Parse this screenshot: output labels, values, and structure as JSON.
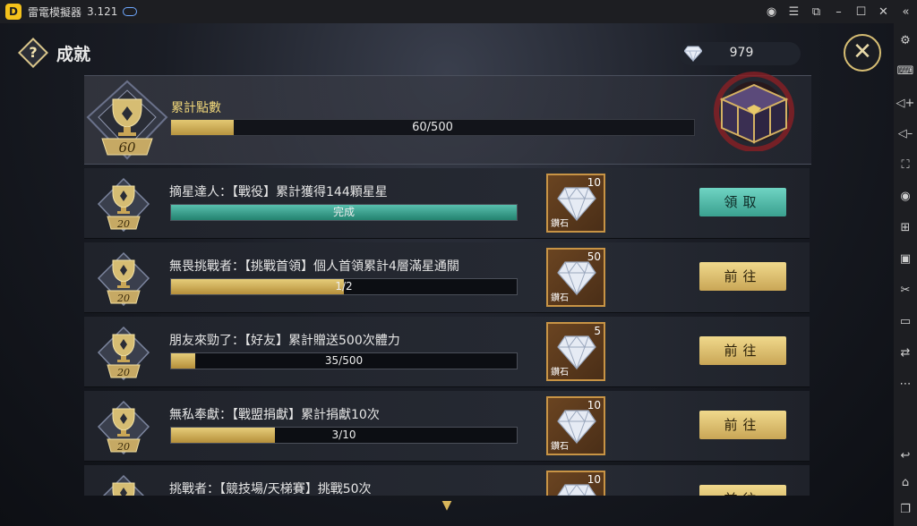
{
  "window": {
    "title": "雷電模擬器",
    "version": "3.121",
    "logo_char": "D",
    "controls": [
      "account-icon",
      "menu-icon",
      "screenshot-icon",
      "minimize-icon",
      "maximize-icon",
      "close-icon",
      "collapse-sidebar-icon"
    ]
  },
  "sidebar": {
    "items": [
      "settings-icon",
      "keyboard-icon",
      "volume-up-icon",
      "volume-down-icon",
      "fullscreen-icon",
      "record-icon",
      "multi-instance-icon",
      "apk-install-icon",
      "cut-icon",
      "video-icon",
      "sync-icon",
      "more-icon",
      "back-icon",
      "home-icon",
      "recents-icon"
    ]
  },
  "header": {
    "help_label": "?",
    "title": "成就",
    "currency_amount": "979",
    "close_label": "✕"
  },
  "summary": {
    "label": "累計點數",
    "level": "60",
    "progress_text": "60/500",
    "progress": 0.12
  },
  "achievements": [
    {
      "name": "摘星達人：【戰役】累計獲得144顆星星",
      "progress_text": "完成",
      "progress": 1.0,
      "done": true,
      "trophy_points": "20",
      "reward_count": "10",
      "reward_label": "鑽石",
      "action": "領取"
    },
    {
      "name": "無畏挑戰者：【挑戰首領】個人首領累計4層滿星通關",
      "progress_text": "1/2",
      "progress": 0.5,
      "done": false,
      "trophy_points": "20",
      "reward_count": "50",
      "reward_label": "鑽石",
      "action": "前往"
    },
    {
      "name": "朋友來勁了：【好友】累計贈送500次體力",
      "progress_text": "35/500",
      "progress": 0.07,
      "done": false,
      "trophy_points": "20",
      "reward_count": "5",
      "reward_label": "鑽石",
      "action": "前往"
    },
    {
      "name": "無私奉獻：【戰盟捐獻】累計捐獻10次",
      "progress_text": "3/10",
      "progress": 0.3,
      "done": false,
      "trophy_points": "20",
      "reward_count": "10",
      "reward_label": "鑽石",
      "action": "前往"
    },
    {
      "name": "挑戰者：【競技場/天梯賽】挑戰50次",
      "progress_text": "",
      "progress": 0.0,
      "done": false,
      "trophy_points": "",
      "reward_count": "10",
      "reward_label": "",
      "action": "前往"
    }
  ],
  "colors": {
    "accent_gold": "#d6bd73",
    "claim_teal": "#4fb8a6",
    "bg_dark": "#0d0f14"
  }
}
